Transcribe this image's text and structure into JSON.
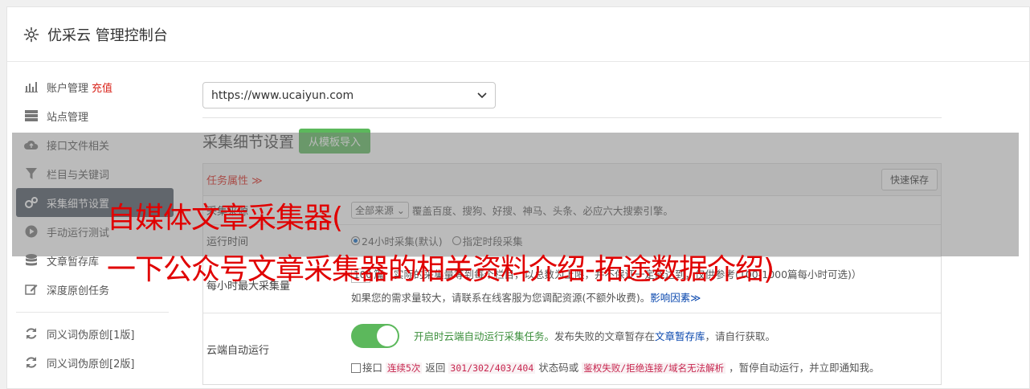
{
  "header": {
    "title": "优采云 管理控制台",
    "icon": "gear-icon"
  },
  "sidebar": {
    "items": [
      {
        "label": "账户管理",
        "extra": "充值",
        "icon": "bar-chart-icon"
      },
      {
        "label": "站点管理",
        "icon": "server-icon"
      },
      {
        "label": "接口文件相关",
        "icon": "cloud-upload-icon"
      },
      {
        "label": "栏目与关键词",
        "icon": "filter-icon"
      },
      {
        "label": "采集细节设置",
        "icon": "gears-icon",
        "active": true
      },
      {
        "label": "手动运行测试",
        "icon": "play-circle-icon"
      },
      {
        "label": "文章暂存库",
        "icon": "database-icon"
      },
      {
        "label": "深度原创任务",
        "icon": "edit-icon"
      },
      {
        "label": "同义词伪原创[1版]",
        "icon": "refresh-icon"
      },
      {
        "label": "同义词伪原创[2版]",
        "icon": "refresh-icon"
      }
    ]
  },
  "main": {
    "site_select": "https://www.ucaiyun.com",
    "section_title": "采集细节设置",
    "import_button": "从模板导入",
    "panel": {
      "task_label": "任务属性 ≫",
      "save_button": "快速保存",
      "rows": {
        "source": {
          "label": "采集来源",
          "select": "全部来源",
          "desc": "覆盖百度、搜狗、好搜、神马、头条、必应六大搜索引擎。"
        },
        "runtime": {
          "label": "运行时间",
          "opt1": "24小时采集(默认)",
          "opt2": "指定时段采集"
        },
        "max": {
          "label": "每小时最大采集量",
          "value": "100",
          "line1": "篇（实际的采集量等到每个栏目，以总数为上限，并不保证一定能达到，仅供参考(100-1000篇每小时可选)）",
          "line2": "如果您的需求量较大，请联系在线客服为您调配资源(不额外收费)。",
          "link": "影响因素≫"
        },
        "cloud": {
          "label": "云端自动运行",
          "toggle_on": true,
          "text_green": "开启时云端自动运行采集任务。",
          "text_mid": "发布失败的文章暂存在",
          "link": "文章暂存库",
          "text_end": "，请自行获取。",
          "chk_label": "接口",
          "code1": "连续5次",
          "t1": "返回",
          "code2": "301/302/403/404",
          "t2": "状态码或",
          "code3": "鉴权失败/拒绝连接/域名无法解析",
          "t3": "，暂停自动运行，并立即通知我。"
        }
      }
    }
  },
  "overlay": {
    "line1": "自媒体文章采集器(",
    "line2": "一下公众号文章采集器的相关资料介绍-拓途数据介绍)"
  }
}
